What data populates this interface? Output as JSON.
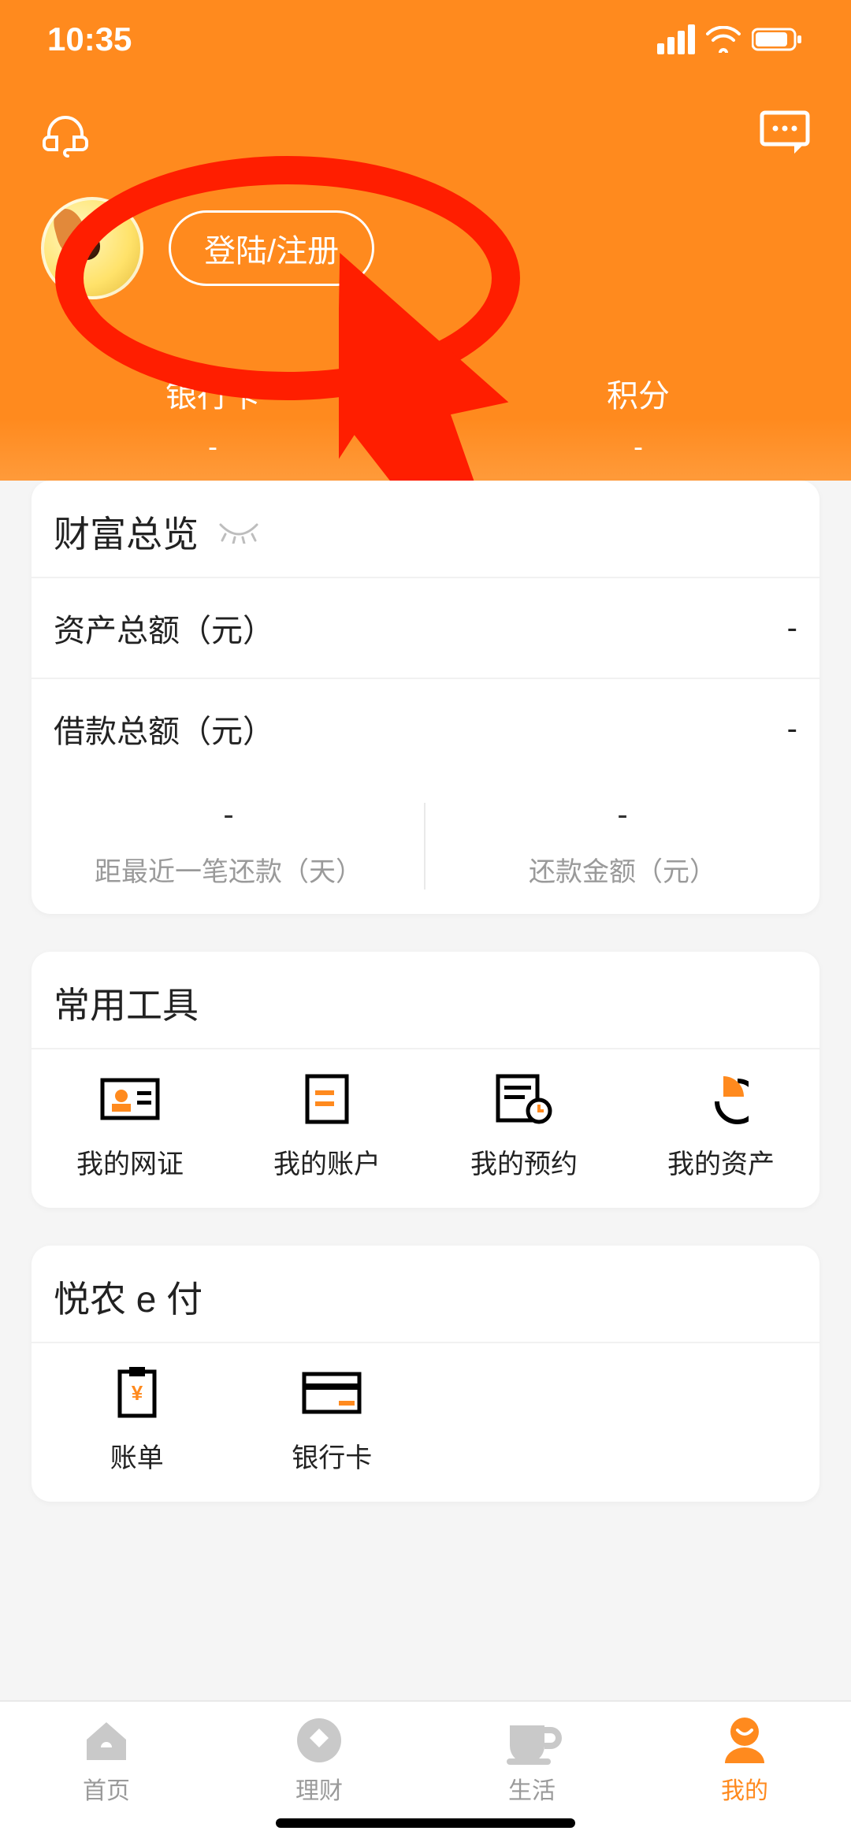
{
  "status": {
    "time": "10:35"
  },
  "header": {
    "login_label": "登陆/注册",
    "stats": [
      {
        "label": "银行卡",
        "value": "-"
      },
      {
        "label": "积分",
        "value": "-"
      }
    ]
  },
  "wealth": {
    "title": "财富总览",
    "rows": [
      {
        "label": "资产总额（元）",
        "value": "-"
      },
      {
        "label": "借款总额（元）",
        "value": "-"
      }
    ],
    "split": [
      {
        "value": "-",
        "caption": "距最近一笔还款（天）"
      },
      {
        "value": "-",
        "caption": "还款金额（元）"
      }
    ]
  },
  "tools": {
    "title": "常用工具",
    "items": [
      {
        "icon": "id-card-icon",
        "label": "我的网证"
      },
      {
        "icon": "document-icon",
        "label": "我的账户"
      },
      {
        "icon": "calendar-clock-icon",
        "label": "我的预约"
      },
      {
        "icon": "pie-chart-icon",
        "label": "我的资产"
      }
    ]
  },
  "pay": {
    "title": "悦农 e 付",
    "items": [
      {
        "icon": "bill-icon",
        "label": "账单"
      },
      {
        "icon": "bank-card-icon",
        "label": "银行卡"
      }
    ]
  },
  "nav": {
    "items": [
      {
        "icon": "home-icon",
        "label": "首页"
      },
      {
        "icon": "coin-icon",
        "label": "理财"
      },
      {
        "icon": "cup-icon",
        "label": "生活"
      },
      {
        "icon": "user-icon",
        "label": "我的"
      }
    ],
    "active_index": 3
  }
}
